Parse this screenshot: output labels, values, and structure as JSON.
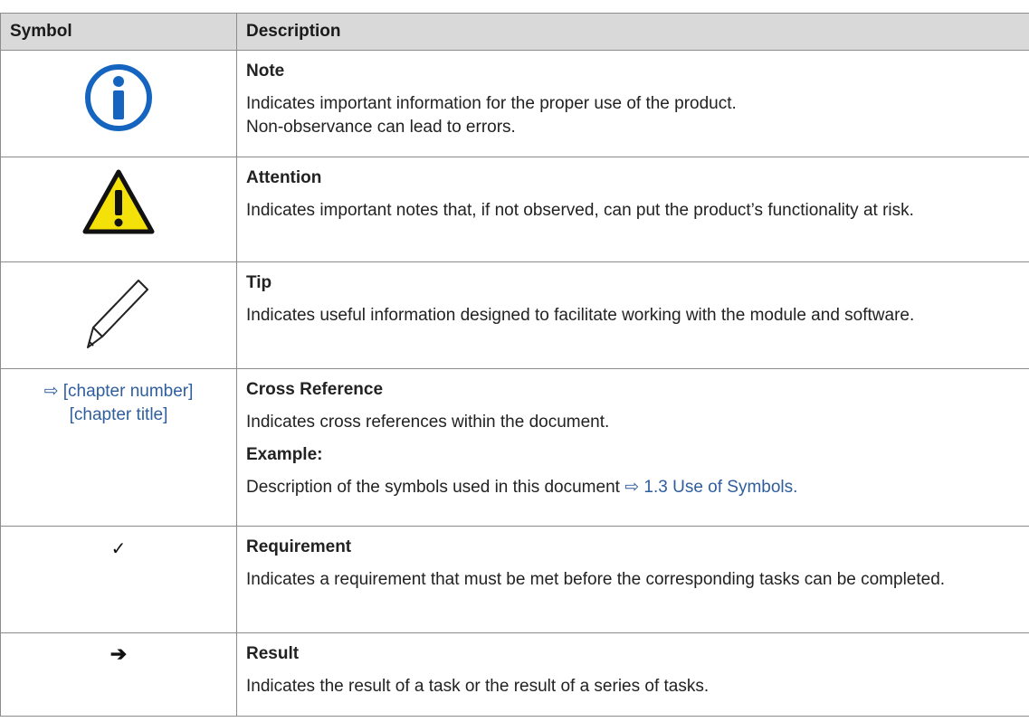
{
  "header": {
    "symbol": "Symbol",
    "description": "Description"
  },
  "rows": [
    {
      "title": "Note",
      "lines": [
        "Indicates important information for the proper use of the product.",
        "Non-observance can lead to errors."
      ],
      "icon": "info-icon"
    },
    {
      "title": "Attention",
      "lines": [
        "Indicates important notes that, if not observed, can put the product’s functionality at risk."
      ],
      "icon": "warning-icon"
    },
    {
      "title": "Tip",
      "lines": [
        "Indicates useful information designed to facilitate working with the module and software."
      ],
      "icon": "pencil-icon"
    },
    {
      "title": "Cross Reference",
      "symbol_text_1": "⇨ [chapter number]",
      "symbol_text_2": "[chapter title]",
      "lines": [
        "Indicates cross references within the document."
      ],
      "example_label": "Example:",
      "example_text": "Description of the symbols used in this document ",
      "example_link": "⇨ 1.3 Use of Symbols."
    },
    {
      "title": "Requirement",
      "symbol_text": "✓",
      "lines": [
        "Indicates a requirement that must be met before the corresponding tasks can be completed."
      ]
    },
    {
      "title": "Result",
      "symbol_text": "➔",
      "lines": [
        "Indicates the result of a task or the result of a series of tasks."
      ]
    }
  ],
  "colors": {
    "header_bg": "#d9d9d9",
    "border": "#8c8c8c",
    "link": "#2f5e9e",
    "info_blue": "#1565c0",
    "warning_yellow": "#f5e10a"
  }
}
